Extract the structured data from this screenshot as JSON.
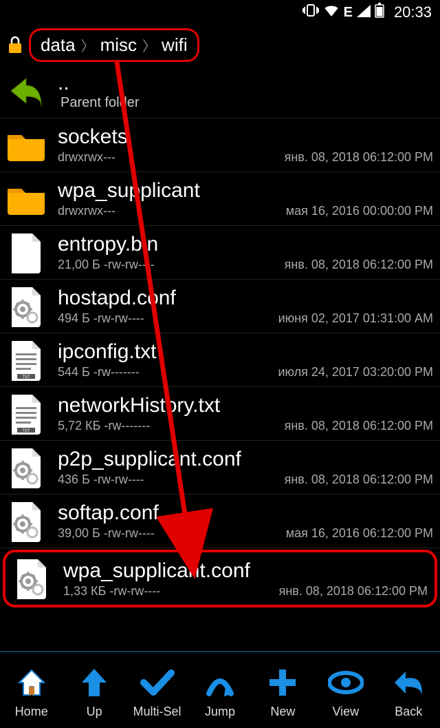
{
  "status": {
    "clock": "20:33"
  },
  "breadcrumb": [
    "data",
    "misc",
    "wifi"
  ],
  "parent": {
    "dots": "..",
    "label": "Parent folder"
  },
  "files": [
    {
      "name": "sockets",
      "meta": "drwxrwx---",
      "date": "янв. 08, 2018 06:12:00 PM",
      "icon": "folder"
    },
    {
      "name": "wpa_supplicant",
      "meta": "drwxrwx---",
      "date": "мая 16, 2016 00:00:00 PM",
      "icon": "folder"
    },
    {
      "name": "entropy.bin",
      "meta": "21,00 Б -rw-rw----",
      "date": "янв. 08, 2018 06:12:00 PM",
      "icon": "file-blank"
    },
    {
      "name": "hostapd.conf",
      "meta": "494 Б -rw-rw----",
      "date": "июня 02, 2017 01:31:00 AM",
      "icon": "file-conf"
    },
    {
      "name": "ipconfig.txt",
      "meta": "544 Б -rw-------",
      "date": "июля 24, 2017 03:20:00 PM",
      "icon": "file-txt"
    },
    {
      "name": "networkHistory.txt",
      "meta": "5,72 КБ -rw-------",
      "date": "янв. 08, 2018 06:12:00 PM",
      "icon": "file-txt"
    },
    {
      "name": "p2p_supplicant.conf",
      "meta": "436 Б -rw-rw----",
      "date": "янв. 08, 2018 06:12:00 PM",
      "icon": "file-conf"
    },
    {
      "name": "softap.conf",
      "meta": "39,00 Б -rw-rw----",
      "date": "мая 16, 2016 06:12:00 PM",
      "icon": "file-conf"
    },
    {
      "name": "wpa_supplicant.conf",
      "meta": "1,33 КБ -rw-rw----",
      "date": "янв. 08, 2018 06:12:00 PM",
      "icon": "file-conf",
      "highlight": true
    }
  ],
  "bottombar": [
    {
      "label": "Home"
    },
    {
      "label": "Up"
    },
    {
      "label": "Multi-Sel"
    },
    {
      "label": "Jump"
    },
    {
      "label": "New"
    },
    {
      "label": "View"
    },
    {
      "label": "Back"
    }
  ]
}
